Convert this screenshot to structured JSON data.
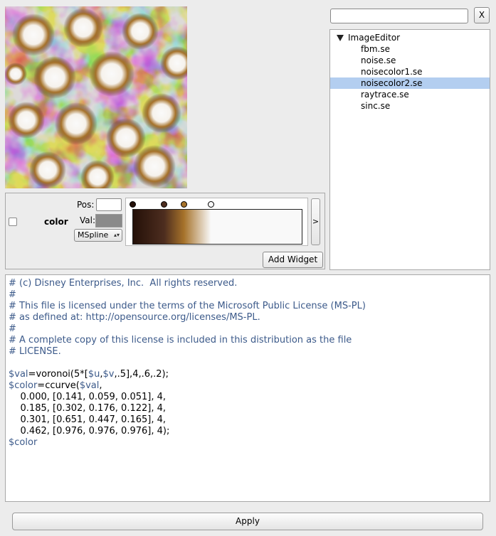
{
  "preview": {
    "alt": "rendered noise image"
  },
  "curve_panel": {
    "variable_name": "color",
    "pos_label": "Pos:",
    "pos_value": "",
    "val_label": "Val:",
    "val_color": "#8a8a8a",
    "interpolation": "MSpline",
    "expand_label": ">",
    "add_widget_label": "Add Widget",
    "control_points": [
      {
        "pos": 0.0,
        "color": "#241008"
      },
      {
        "pos": 0.185,
        "color": "#4d2d1f"
      },
      {
        "pos": 0.301,
        "color": "#a6722a"
      },
      {
        "pos": 0.462,
        "color": "#f9f9f9"
      }
    ]
  },
  "search": {
    "value": "",
    "clear_label": "X"
  },
  "file_tree": {
    "root": "ImageEditor",
    "items": [
      "fbm.se",
      "noise.se",
      "noisecolor1.se",
      "noisecolor2.se",
      "raytrace.se",
      "sinc.se"
    ],
    "selected_index": 3
  },
  "editor": {
    "lines": [
      "# (c) Disney Enterprises, Inc.  All rights reserved.",
      "#",
      "# This file is licensed under the terms of the Microsoft Public License (MS-PL)",
      "# as defined at: http://opensource.org/licenses/MS-PL.",
      "#",
      "# A complete copy of this license is included in this distribution as the file",
      "# LICENSE.",
      "",
      "$val=voronoi(5*[$u,$v,.5],4,.6,.2);",
      "$color=ccurve($val,",
      "    0.000, [0.141, 0.059, 0.051], 4,",
      "    0.185, [0.302, 0.176, 0.122], 4,",
      "    0.301, [0.651, 0.447, 0.165], 4,",
      "    0.462, [0.976, 0.976, 0.976], 4);",
      "$color"
    ]
  },
  "apply_label": "Apply"
}
